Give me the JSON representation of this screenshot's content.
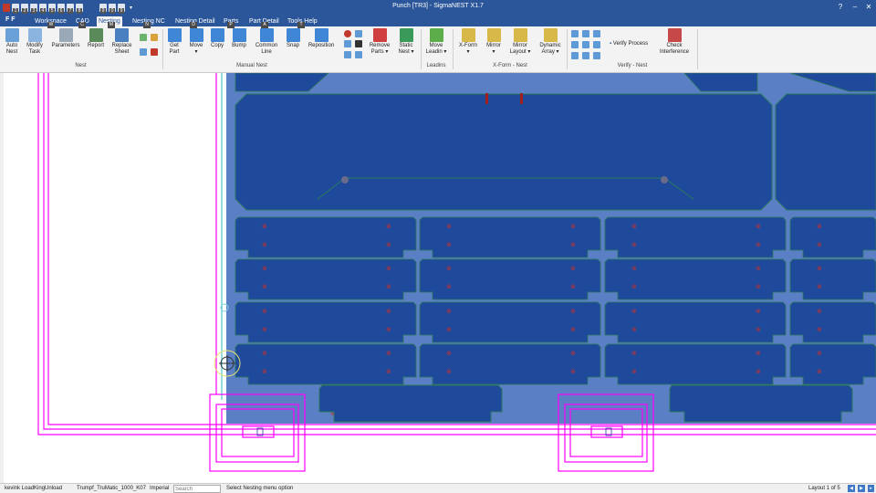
{
  "window": {
    "title": "Punch [TR3] - SigmaNEST X1.7"
  },
  "quick_access": {
    "brand": "F F",
    "keys": [
      "1",
      "2",
      "3",
      "4",
      "5",
      "6",
      "7",
      "8",
      "9",
      "0",
      "9"
    ]
  },
  "tabs": [
    {
      "label": "Workspace",
      "key": "W"
    },
    {
      "label": "CAD",
      "key": "C"
    },
    {
      "label": "Nesting",
      "key": "M",
      "active": true
    },
    {
      "label": "Nesting NC",
      "key": "N"
    },
    {
      "label": "Nesting Detail",
      "key": "D"
    },
    {
      "label": "Parts",
      "key": "P"
    },
    {
      "label": "Part Detail",
      "key": "A"
    },
    {
      "label": "Tools Help",
      "key": "T"
    }
  ],
  "ribbon": {
    "groups": {
      "nest": "Nest",
      "manual_nest": "Manual Nest",
      "leadins": "Leadins",
      "xform": "X-Form - Nest",
      "verify": "Verify - Nest"
    },
    "buttons": {
      "auto_nest": "Auto\nNest",
      "modify_task": "Modify\nTask",
      "parameters": "Parameters",
      "report": "Report",
      "replace_sheet": "Replace\nSheet",
      "get_part": "Get\nPart",
      "move": "Move\n▾",
      "copy": "Copy",
      "bump": "Bump",
      "common_line": "Common\nLine",
      "snap": "Snap",
      "reposition": "Reposition",
      "remove_parts": "Remove\nParts ▾",
      "static_nest": "Static\nNest ▾",
      "move_leadin": "Move\nLeadin ▾",
      "xform": "X-Form\n▾",
      "mirror": "Mirror\n▾",
      "mirror_layout": "Mirror\nLayout ▾",
      "dynamic_array": "Dynamic\nArray ▾",
      "verify_process": "Verify Process",
      "check_interference": "Check\nInterference"
    }
  },
  "status": {
    "user": "kevink LoadKingUnload",
    "machine": "Trumpf_TruMatic_1000_K07",
    "units": "Imperial",
    "search_placeholder": "Search",
    "message": "Select Nesting menu option",
    "layout": "Layout 1 of 5"
  },
  "colors": {
    "sheet": "#5b7fc4",
    "part": "#1f4a9c",
    "accent": "#2b579a",
    "highlight": "#ff00ff"
  }
}
